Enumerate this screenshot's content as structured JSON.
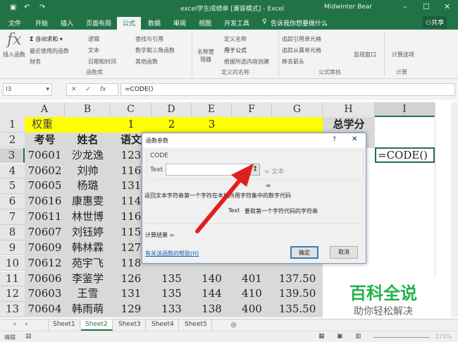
{
  "title_bar": {
    "title": "excel学生成绩单 [兼容模式] - Excel",
    "user": "Midwinter Bear"
  },
  "menu_tabs": [
    "文件",
    "开始",
    "插入",
    "页面布局",
    "公式",
    "数据",
    "审阅",
    "视图",
    "开发工具"
  ],
  "active_tab": "公式",
  "tell_me": "告诉我你想要做什么",
  "share": "共享",
  "ribbon": {
    "insert_function": "插入函数",
    "fx": "fx",
    "autosum": "自动求和",
    "recent": "最近使用的函数",
    "financial": "财务",
    "logical": "逻辑",
    "text": "文本",
    "datetime": "日期和时间",
    "lookup": "查找与引用",
    "math": "数学和三角函数",
    "other": "其他函数",
    "group_library": "函数库",
    "name_manager": "名称管理器",
    "define_name": "定义名称",
    "use_in_formula": "用于公式",
    "create_from_selection": "根据所选内容创建",
    "group_names": "定义的名称",
    "trace_precedents": "追踪引用单元格",
    "trace_dependents": "追踪从属单元格",
    "remove_arrows": "移去箭头",
    "group_audit": "公式审核",
    "watch_window": "监视窗口",
    "calc_options": "计算选项",
    "group_calc": "计算"
  },
  "formula_bar": {
    "name_box": "I3",
    "formula": "=CODE()",
    "cancel": "✕",
    "enter": "✓",
    "fx": "fx"
  },
  "columns": [
    "A",
    "B",
    "C",
    "D",
    "E",
    "F",
    "G",
    "H",
    "I"
  ],
  "rows": [
    "1",
    "2",
    "3",
    "4",
    "5",
    "6",
    "7",
    "8",
    "9",
    "10",
    "11",
    "12",
    "13"
  ],
  "row1": {
    "a": "权重",
    "c": "1",
    "d": "2",
    "e": "3",
    "h": "总学分"
  },
  "row2": {
    "a": "考号",
    "b": "姓名",
    "c": "语文"
  },
  "students": [
    {
      "id": "70601",
      "name": "沙龙逸",
      "c": "123"
    },
    {
      "id": "70602",
      "name": "刘帅",
      "c": "116"
    },
    {
      "id": "70605",
      "name": "杨璐",
      "c": "131"
    },
    {
      "id": "70616",
      "name": "康惠雯",
      "c": "114"
    },
    {
      "id": "70611",
      "name": "林世博",
      "c": "116"
    },
    {
      "id": "70607",
      "name": "刘钰婷",
      "c": "115"
    },
    {
      "id": "70609",
      "name": "韩林霖",
      "c": "127"
    },
    {
      "id": "70612",
      "name": "苑宇飞",
      "c": "118"
    },
    {
      "id": "70606",
      "name": "李鉴学",
      "c": "126",
      "d": "135",
      "e": "140",
      "f": "401",
      "g": "137.50"
    },
    {
      "id": "70603",
      "name": "王雪",
      "c": "131",
      "d": "135",
      "e": "144",
      "f": "410",
      "g": "139.50"
    },
    {
      "id": "70604",
      "name": "韩雨萌",
      "c": "129",
      "d": "133",
      "e": "138",
      "f": "400",
      "g": "135.50"
    }
  ],
  "active_cell": "=CODE()",
  "dialog": {
    "title": "函数参数",
    "help": "?",
    "close": "✕",
    "function": "CODE",
    "arg_label": "Text",
    "arg_value": "",
    "arg_result": "= 文本",
    "eq": "=",
    "description": "返回文本字符串第一个字符在本机所用字符集中的数字代码",
    "arg_desc_label": "Text",
    "arg_desc": "要取第一个字符代码的字符串",
    "result_label": "计算结果 =",
    "help_link": "有关该函数的帮助(H)",
    "ok": "确定",
    "cancel": "取消"
  },
  "sheets": [
    "Sheet1",
    "Sheet2",
    "Sheet3",
    "Sheet4",
    "Sheet5"
  ],
  "active_sheet": "Sheet2",
  "status": {
    "mode": "编辑",
    "zoom": "171%"
  },
  "watermark": {
    "main": "百科全说",
    "sub": "助你轻松解决"
  }
}
